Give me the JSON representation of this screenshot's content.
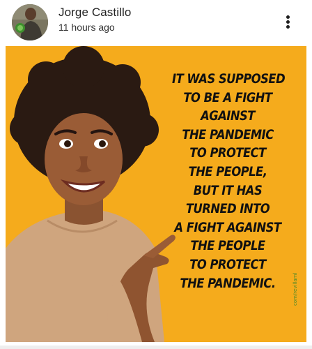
{
  "post": {
    "author": "Jorge Castillo",
    "time": "11 hours ago",
    "menu_icon": "more-vertical-icon",
    "avatar_icon": "profile-photo"
  },
  "meme": {
    "lines": [
      "IT WAS SUPPOSED",
      "TO BE A FIGHT",
      "AGAINST",
      "THE PANDEMIC",
      "TO PROTECT",
      "THE PEOPLE,",
      "BUT IT HAS",
      "TURNED INTO",
      "A FIGHT AGAINST",
      "THE PEOPLE",
      "TO PROTECT",
      "THE PANDEMIC."
    ],
    "watermark": "com/revillaml",
    "background_color": "#f5ab1c",
    "text_color": "#111111"
  }
}
